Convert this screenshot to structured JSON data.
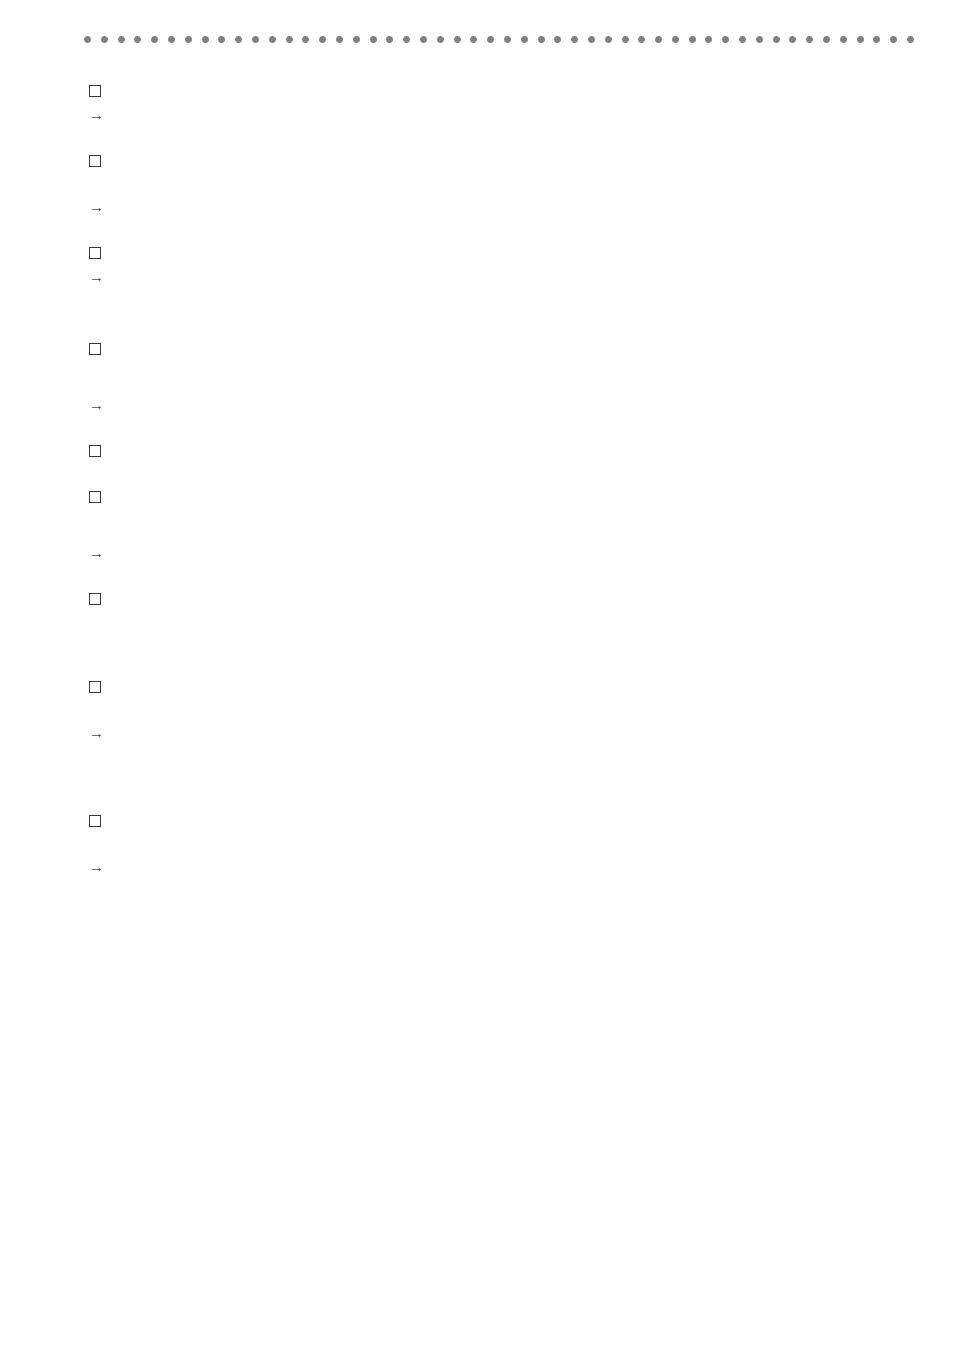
{
  "decor": {
    "dot_count": 50
  },
  "items": [
    {
      "type": "square"
    },
    {
      "type": "gap",
      "size": "small"
    },
    {
      "type": "arrow"
    },
    {
      "type": "gap",
      "size": "med"
    },
    {
      "type": "square"
    },
    {
      "type": "gap",
      "size": "med"
    },
    {
      "type": "arrow"
    },
    {
      "type": "gap",
      "size": "med"
    },
    {
      "type": "square"
    },
    {
      "type": "gap",
      "size": "small"
    },
    {
      "type": "arrow"
    },
    {
      "type": "gap",
      "size": "large"
    },
    {
      "type": "square"
    },
    {
      "type": "gap",
      "size": "big"
    },
    {
      "type": "arrow"
    },
    {
      "type": "gap",
      "size": "med"
    },
    {
      "type": "square"
    },
    {
      "type": "gap",
      "size": "med"
    },
    {
      "type": "square"
    },
    {
      "type": "gap",
      "size": "big"
    },
    {
      "type": "arrow"
    },
    {
      "type": "gap",
      "size": "med"
    },
    {
      "type": "square"
    },
    {
      "type": "gap",
      "size": "xl"
    },
    {
      "type": "square"
    },
    {
      "type": "gap",
      "size": "med"
    },
    {
      "type": "arrow"
    },
    {
      "type": "gap",
      "size": "xl"
    },
    {
      "type": "square"
    },
    {
      "type": "gap",
      "size": "med"
    },
    {
      "type": "arrow"
    }
  ]
}
